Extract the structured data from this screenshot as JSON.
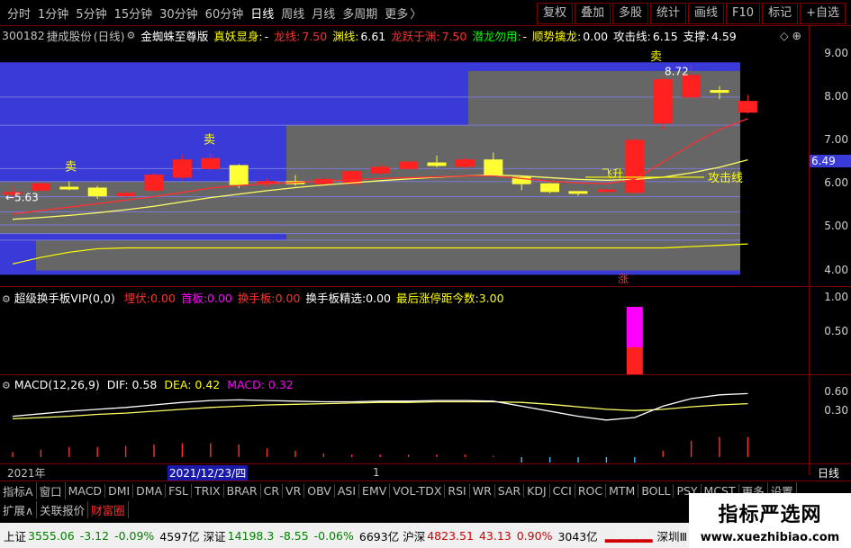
{
  "periods": [
    "分时",
    "1分钟",
    "5分钟",
    "15分钟",
    "30分钟",
    "60分钟",
    "日线",
    "周线",
    "月线",
    "多周期",
    "更多"
  ],
  "active_period": "日线",
  "toolbar": [
    "复权",
    "叠加",
    "多股",
    "统计",
    "画线",
    "F10",
    "标记",
    "+自选"
  ],
  "stock": {
    "code": "300182",
    "name": "捷成股份",
    "period": "(日线)"
  },
  "indicator_main": {
    "name": "金蜘蛛至尊版",
    "items": [
      {
        "label": "真妖显身:",
        "value": "-",
        "color": "#ffff00",
        "vcolor": "#ffffff"
      },
      {
        "label": "龙线:",
        "value": "7.50",
        "color": "#ff3030",
        "vcolor": "#ff3030"
      },
      {
        "label": "渊线:",
        "value": "6.61",
        "color": "#ffff00",
        "vcolor": "#ffffff"
      },
      {
        "label": "龙跃于渊:",
        "value": "7.50",
        "color": "#ff3030",
        "vcolor": "#ff3030"
      },
      {
        "label": "潜龙勿用:",
        "value": "-",
        "color": "#00ff00",
        "vcolor": "#ffffff"
      },
      {
        "label": "顺势擒龙:",
        "value": "0.00",
        "color": "#ffff00",
        "vcolor": "#ffffff"
      },
      {
        "label": "攻击线:",
        "value": "6.15",
        "color": "#ffffff",
        "vcolor": "#ffffff"
      },
      {
        "label": "支撑:",
        "value": "4.59",
        "color": "#ffffff",
        "vcolor": "#ffffff"
      }
    ]
  },
  "price_axis": {
    "ticks": [
      "9.00",
      "8.00",
      "7.00",
      "6.00",
      "5.00",
      "4.00"
    ],
    "current": "6.49",
    "ymin": 3.7,
    "ymax": 9.2
  },
  "annotations": {
    "sell": "卖",
    "hi_label": "8.72",
    "lo_label": "←5.63",
    "up_label": "飞升",
    "attack_label": "攻击线",
    "zhang": "涨"
  },
  "candles": [
    {
      "o": 5.78,
      "c": 5.8,
      "h": 5.95,
      "l": 5.65
    },
    {
      "o": 5.85,
      "c": 6.0,
      "h": 6.08,
      "l": 5.8
    },
    {
      "o": 5.92,
      "c": 5.88,
      "h": 6.05,
      "l": 5.85
    },
    {
      "o": 5.9,
      "c": 5.72,
      "h": 5.95,
      "l": 5.65
    },
    {
      "o": 5.72,
      "c": 5.78,
      "h": 5.85,
      "l": 5.68
    },
    {
      "o": 5.85,
      "c": 6.2,
      "h": 6.25,
      "l": 5.82
    },
    {
      "o": 6.15,
      "c": 6.55,
      "h": 6.65,
      "l": 6.1
    },
    {
      "o": 6.35,
      "c": 6.58,
      "h": 6.7,
      "l": 6.3
    },
    {
      "o": 6.42,
      "c": 5.98,
      "h": 6.45,
      "l": 5.9
    },
    {
      "o": 6.0,
      "c": 6.05,
      "h": 6.12,
      "l": 5.92
    },
    {
      "o": 6.05,
      "c": 6.0,
      "h": 6.2,
      "l": 5.95
    },
    {
      "o": 6.0,
      "c": 6.1,
      "h": 6.3,
      "l": 5.95
    },
    {
      "o": 6.0,
      "c": 6.28,
      "h": 6.3,
      "l": 5.98
    },
    {
      "o": 6.25,
      "c": 6.38,
      "h": 6.45,
      "l": 6.2
    },
    {
      "o": 6.35,
      "c": 6.5,
      "h": 6.6,
      "l": 6.3
    },
    {
      "o": 6.48,
      "c": 6.42,
      "h": 6.65,
      "l": 6.38
    },
    {
      "o": 6.4,
      "c": 6.55,
      "h": 6.6,
      "l": 6.35
    },
    {
      "o": 6.55,
      "c": 6.2,
      "h": 6.72,
      "l": 6.18
    },
    {
      "o": 6.15,
      "c": 6.0,
      "h": 6.18,
      "l": 5.85
    },
    {
      "o": 6.0,
      "c": 5.82,
      "h": 6.02,
      "l": 5.78
    },
    {
      "o": 5.82,
      "c": 5.78,
      "h": 5.82,
      "l": 5.72
    },
    {
      "o": 5.85,
      "c": 5.86,
      "h": 5.9,
      "l": 5.8
    },
    {
      "o": 5.8,
      "c": 7.0,
      "h": 7.05,
      "l": 5.78
    },
    {
      "o": 7.4,
      "c": 8.4,
      "h": 8.45,
      "l": 7.25
    },
    {
      "o": 8.0,
      "c": 8.5,
      "h": 8.72,
      "l": 7.88
    },
    {
      "o": 8.15,
      "c": 8.12,
      "h": 8.25,
      "l": 7.95
    },
    {
      "o": 7.65,
      "c": 7.9,
      "h": 8.05,
      "l": 7.62
    }
  ],
  "ma_yellow": [
    5.18,
    5.22,
    5.27,
    5.33,
    5.4,
    5.48,
    5.58,
    5.68,
    5.76,
    5.84,
    5.91,
    5.97,
    6.02,
    6.07,
    6.11,
    6.15,
    6.18,
    6.2,
    6.18,
    6.14,
    6.1,
    6.08,
    6.1,
    6.15,
    6.25,
    6.38,
    6.55
  ],
  "ma_red": [
    5.3,
    5.38,
    5.46,
    5.54,
    5.62,
    5.7,
    5.8,
    5.9,
    5.96,
    6.0,
    6.03,
    6.06,
    6.09,
    6.12,
    6.14,
    6.16,
    6.18,
    6.18,
    6.12,
    6.06,
    6.02,
    6.0,
    6.1,
    6.5,
    6.9,
    7.25,
    7.5
  ],
  "ma_support": [
    4.15,
    4.3,
    4.42,
    4.5,
    4.52,
    4.52,
    4.52,
    4.52,
    4.52,
    4.52,
    4.52,
    4.52,
    4.52,
    4.52,
    4.52,
    4.52,
    4.52,
    4.52,
    4.52,
    4.52,
    4.52,
    4.52,
    4.52,
    4.52,
    4.55,
    4.58,
    4.61
  ],
  "sub_indicator": {
    "name": "超级换手板VIP(0,0)",
    "items": [
      {
        "label": "埋伏:",
        "value": "0.00",
        "color": "#ff3030"
      },
      {
        "label": "首板:",
        "value": "0.00",
        "color": "#ff00ff"
      },
      {
        "label": "换手板:",
        "value": "0.00",
        "color": "#ff3030"
      },
      {
        "label": "换手板精选:",
        "value": "0.00",
        "color": "#ffffff"
      },
      {
        "label": "最后涨停距今数:",
        "value": "3.00",
        "color": "#ffff00"
      }
    ],
    "ticks": [
      "1.00",
      "0.50"
    ]
  },
  "macd": {
    "name": "MACD(12,26,9)",
    "dif_label": "DIF:",
    "dif": "0.58",
    "dea_label": "DEA:",
    "dea": "0.42",
    "macd_label": "MACD:",
    "macd_val": "0.32",
    "ticks": [
      "0.60",
      "0.30"
    ],
    "dif_series": [
      0.22,
      0.26,
      0.3,
      0.33,
      0.36,
      0.4,
      0.44,
      0.47,
      0.48,
      0.47,
      0.46,
      0.45,
      0.45,
      0.46,
      0.46,
      0.47,
      0.47,
      0.46,
      0.38,
      0.3,
      0.22,
      0.16,
      0.2,
      0.38,
      0.5,
      0.56,
      0.58
    ],
    "dea_series": [
      0.18,
      0.2,
      0.22,
      0.25,
      0.27,
      0.3,
      0.33,
      0.36,
      0.38,
      0.4,
      0.41,
      0.42,
      0.43,
      0.44,
      0.44,
      0.45,
      0.45,
      0.45,
      0.44,
      0.41,
      0.37,
      0.33,
      0.31,
      0.33,
      0.37,
      0.4,
      0.42
    ],
    "hist": [
      0.08,
      0.12,
      0.16,
      0.16,
      0.18,
      0.2,
      0.22,
      0.22,
      0.2,
      0.14,
      0.1,
      0.06,
      0.04,
      0.04,
      0.04,
      0.04,
      0.04,
      0.02,
      -0.12,
      -0.22,
      -0.3,
      -0.34,
      -0.22,
      0.1,
      0.26,
      0.32,
      0.32
    ]
  },
  "datebar": {
    "year": "2021年",
    "cursor_date": "2021/12/23/四",
    "month": "1",
    "period": "日线"
  },
  "tabs": [
    "指标A",
    "窗口",
    "MACD",
    "DMI",
    "DMA",
    "FSL",
    "TRIX",
    "BRAR",
    "CR",
    "VR",
    "OBV",
    "ASI",
    "EMV",
    "VOL-TDX",
    "RSI",
    "WR",
    "SAR",
    "KDJ",
    "CCI",
    "ROC",
    "MTM",
    "BOLL",
    "PSY",
    "MCST",
    "更多",
    "设置"
  ],
  "tabs2": [
    "扩展∧",
    "关联报价",
    "财富圈"
  ],
  "status": [
    {
      "name": "上证",
      "val": "3555.06",
      "chg": "-3.12",
      "pct": "-0.09%",
      "amt": "4597亿",
      "color": "#008000"
    },
    {
      "name": "深证",
      "val": "14198.3",
      "chg": "-8.55",
      "pct": "-0.06%",
      "amt": "6693亿",
      "color": "#008000"
    },
    {
      "name": "沪深",
      "val": "4823.51",
      "chg": "43.13",
      "pct": "0.90%",
      "amt": "3043亿",
      "color": "#d00000"
    }
  ],
  "status_end": "深圳Ⅲ",
  "logo": {
    "cn": "指标严选网",
    "url": "www.xuezhibiao.com"
  }
}
